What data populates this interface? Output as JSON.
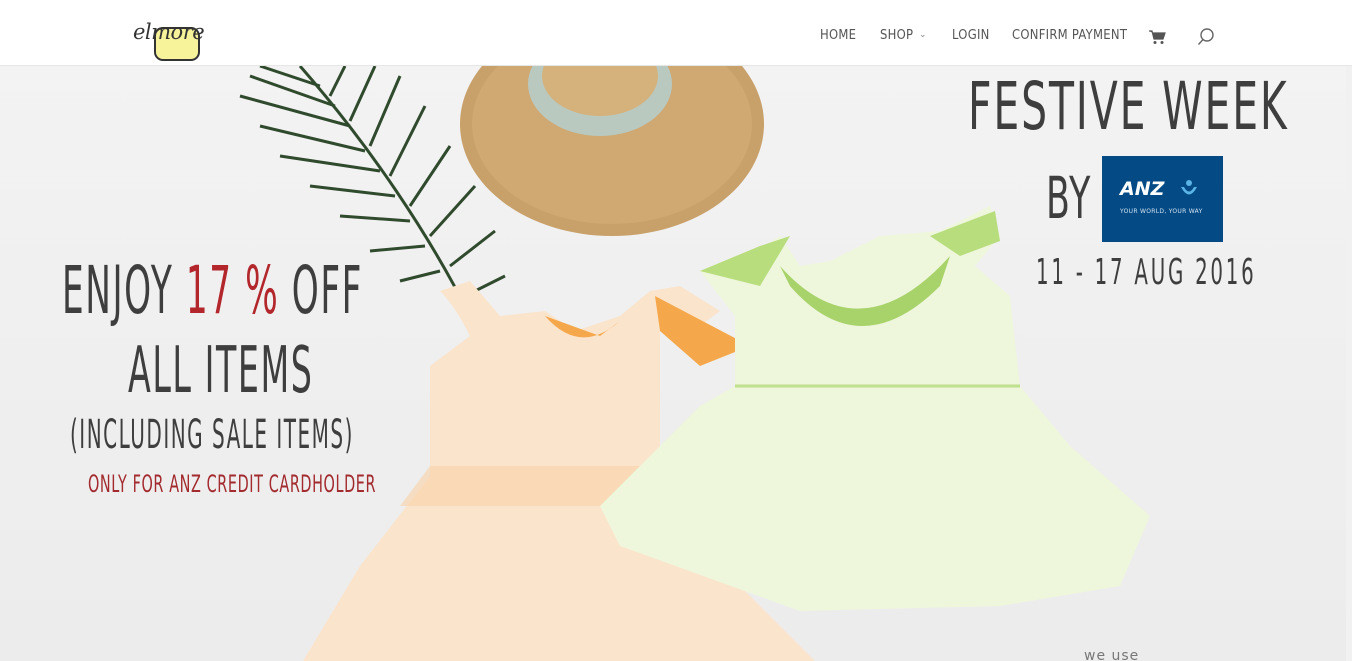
{
  "header": {
    "logo_text": "elmore",
    "nav": {
      "home": "HOME",
      "shop": "SHOP",
      "login": "LOGIN",
      "confirm_payment": "CONFIRM PAYMENT"
    },
    "icons": [
      "chevron-down-icon",
      "cart-icon",
      "search-icon"
    ]
  },
  "hero": {
    "festive_title": "FESTIVE WEEK",
    "by": "BY",
    "anz_name": "ANZ",
    "anz_tagline": "YOUR WORLD, YOUR WAY",
    "dates": "11 - 17 AUG 2016",
    "enjoy_prefix": "ENJOY ",
    "percent": "17 %",
    "enjoy_suffix": " OFF",
    "all_items": "ALL ITEMS",
    "including": "(INCLUDING SALE ITEMS)",
    "only_for": "ONLY FOR ANZ CREDIT CARDHOLDER",
    "footer_snippet": "we use"
  },
  "colors": {
    "accent_red": "#b2262c",
    "anz_blue": "#044a85",
    "logo_yellow": "#f7f39a",
    "text_dark": "#3e3e3e"
  }
}
